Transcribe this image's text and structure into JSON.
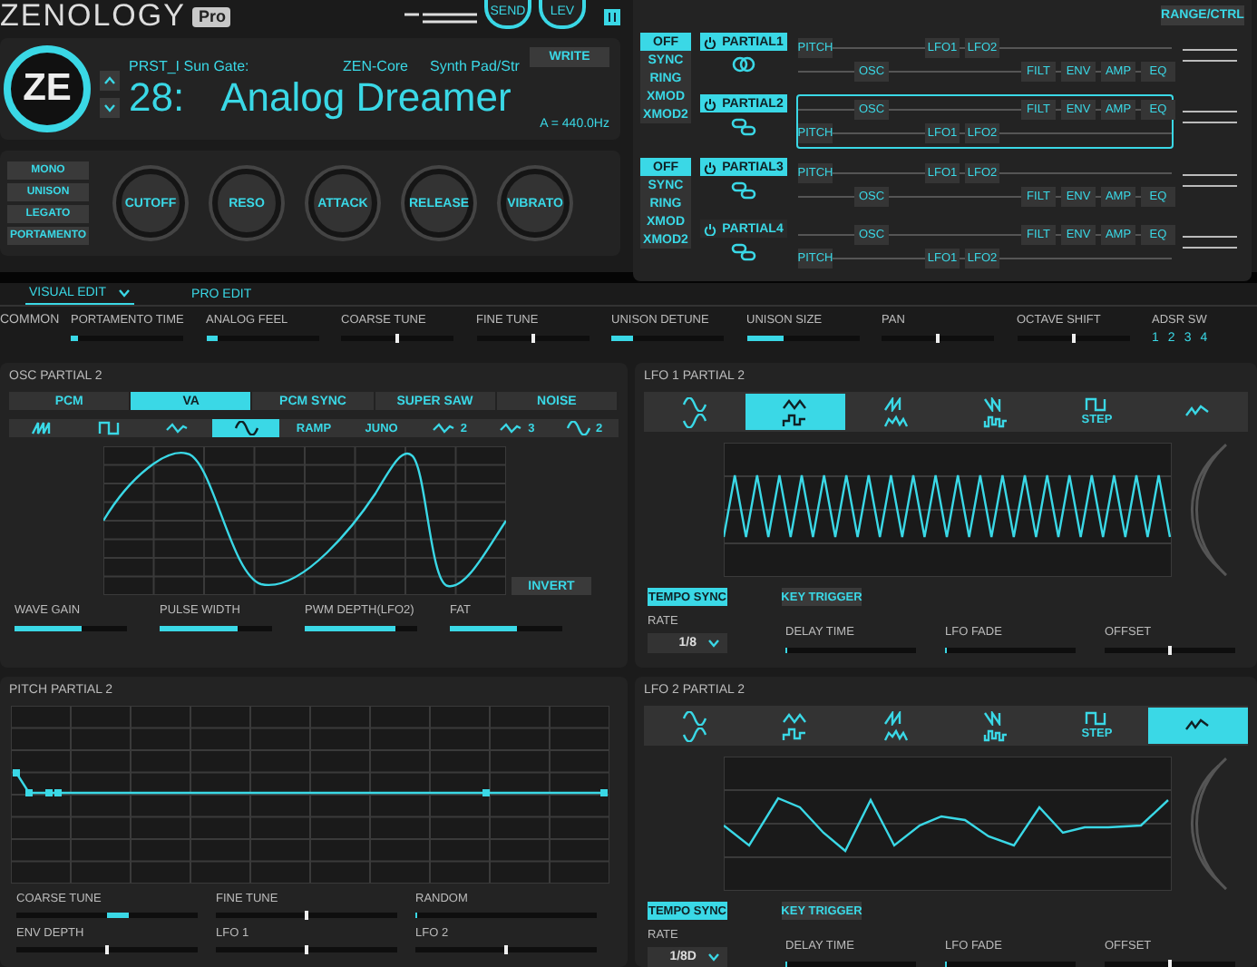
{
  "app": {
    "logo": "ZENOLOGY",
    "badge": "Pro",
    "send": "SEND",
    "lev": "LEV"
  },
  "patch": {
    "logo_mark": "ZE",
    "bank": "PRST_I Sun Gate:",
    "engine": "ZEN-Core",
    "category": "Synth Pad/Str",
    "number": "28:",
    "name": "Analog Dreamer",
    "write": "WRITE",
    "tuning": "A = 440.0Hz"
  },
  "mode_buttons": [
    "MONO",
    "UNISON",
    "LEGATO",
    "PORTAMENTO"
  ],
  "knobs": [
    "CUTOFF",
    "RESO",
    "ATTACK",
    "RELEASE",
    "VIBRATO"
  ],
  "structure": {
    "range_button": "RANGE/CTRL",
    "groups": [
      {
        "modes": [
          {
            "label": "OFF",
            "selected": true
          },
          {
            "label": "SYNC",
            "selected": false
          },
          {
            "label": "RING",
            "selected": false
          },
          {
            "label": "XMOD",
            "selected": false
          },
          {
            "label": "XMOD2",
            "selected": false
          }
        ],
        "partials": [
          {
            "label": "PARTIAL1",
            "on": true,
            "linked": true,
            "selected": false,
            "top": [
              {
                "kind": "pitch",
                "label": "PITCH"
              },
              {
                "kind": "lfo1",
                "label": "LFO1"
              },
              {
                "kind": "lfo2",
                "label": "LFO2"
              }
            ],
            "bottom": [
              {
                "kind": "osc",
                "label": "OSC"
              },
              {
                "kind": "filt",
                "label": "FILT"
              },
              {
                "kind": "env",
                "label": "ENV"
              },
              {
                "kind": "amp",
                "label": "AMP"
              },
              {
                "kind": "eq",
                "label": "EQ"
              }
            ]
          },
          {
            "label": "PARTIAL2",
            "on": true,
            "linked": false,
            "selected": true,
            "top": [
              {
                "kind": "osc",
                "label": "OSC"
              },
              {
                "kind": "filt",
                "label": "FILT"
              },
              {
                "kind": "env",
                "label": "ENV"
              },
              {
                "kind": "amp",
                "label": "AMP"
              },
              {
                "kind": "eq",
                "label": "EQ"
              }
            ],
            "bottom": [
              {
                "kind": "pitch",
                "label": "PITCH"
              },
              {
                "kind": "lfo1",
                "label": "LFO1"
              },
              {
                "kind": "lfo2",
                "label": "LFO2"
              }
            ]
          }
        ]
      },
      {
        "modes": [
          {
            "label": "OFF",
            "selected": true
          },
          {
            "label": "SYNC",
            "selected": false
          },
          {
            "label": "RING",
            "selected": false
          },
          {
            "label": "XMOD",
            "selected": false
          },
          {
            "label": "XMOD2",
            "selected": false
          }
        ],
        "partials": [
          {
            "label": "PARTIAL3",
            "on": true,
            "linked": false,
            "selected": false,
            "top": [
              {
                "kind": "pitch",
                "label": "PITCH"
              },
              {
                "kind": "lfo1",
                "label": "LFO1"
              },
              {
                "kind": "lfo2",
                "label": "LFO2"
              }
            ],
            "bottom": [
              {
                "kind": "osc",
                "label": "OSC"
              },
              {
                "kind": "filt",
                "label": "FILT"
              },
              {
                "kind": "env",
                "label": "ENV"
              },
              {
                "kind": "amp",
                "label": "AMP"
              },
              {
                "kind": "eq",
                "label": "EQ"
              }
            ]
          },
          {
            "label": "PARTIAL4",
            "on": false,
            "linked": false,
            "selected": false,
            "top": [
              {
                "kind": "osc",
                "label": "OSC"
              },
              {
                "kind": "filt",
                "label": "FILT"
              },
              {
                "kind": "env",
                "label": "ENV"
              },
              {
                "kind": "amp",
                "label": "AMP"
              },
              {
                "kind": "eq",
                "label": "EQ"
              }
            ],
            "bottom": [
              {
                "kind": "pitch",
                "label": "PITCH"
              },
              {
                "kind": "lfo1",
                "label": "LFO1"
              },
              {
                "kind": "lfo2",
                "label": "LFO2"
              }
            ]
          }
        ]
      }
    ]
  },
  "edit_tabs": [
    {
      "label": "VISUAL EDIT",
      "selected": true
    },
    {
      "label": "PRO EDIT",
      "selected": false
    }
  ],
  "common": {
    "label": "COMMON",
    "params": [
      {
        "label": "PORTAMENTO TIME",
        "kind": "bar",
        "level": 0.07
      },
      {
        "label": "ANALOG FEEL",
        "kind": "bar",
        "level": 0.1
      },
      {
        "label": "COARSE TUNE",
        "kind": "dot",
        "level": 0.5
      },
      {
        "label": "FINE TUNE",
        "kind": "dot",
        "level": 0.5
      },
      {
        "label": "UNISON DETUNE",
        "kind": "bar",
        "level": 0.2
      },
      {
        "label": "UNISON SIZE",
        "kind": "bar",
        "level": 0.33
      },
      {
        "label": "PAN",
        "kind": "dot",
        "level": 0.5
      },
      {
        "label": "OCTAVE SHIFT",
        "kind": "dot",
        "level": 0.5
      }
    ],
    "adsr_sw": {
      "label": "ADSR SW",
      "buttons": [
        "1",
        "2",
        "3",
        "4"
      ]
    }
  },
  "osc": {
    "title": "OSC PARTIAL 2",
    "types": [
      {
        "label": "PCM",
        "selected": false
      },
      {
        "label": "VA",
        "selected": true
      },
      {
        "label": "PCM SYNC",
        "selected": false
      },
      {
        "label": "SUPER SAW",
        "selected": false
      },
      {
        "label": "NOISE",
        "selected": false
      }
    ],
    "waves": [
      {
        "kind": "saw",
        "selected": false
      },
      {
        "kind": "square",
        "selected": false
      },
      {
        "kind": "triangle",
        "selected": false
      },
      {
        "kind": "sine",
        "selected": true
      },
      {
        "kind": "text",
        "label": "RAMP",
        "selected": false
      },
      {
        "kind": "text",
        "label": "JUNO",
        "selected": false
      },
      {
        "kind": "triangle",
        "label": "2",
        "selected": false
      },
      {
        "kind": "triangle",
        "label": "3",
        "selected": false
      },
      {
        "kind": "sine",
        "label": "2",
        "selected": false
      }
    ],
    "invert": "INVERT",
    "params": [
      {
        "label": "WAVE GAIN",
        "kind": "bar",
        "level": 0.6
      },
      {
        "label": "PULSE WIDTH",
        "kind": "bar",
        "level": 0.7
      },
      {
        "label": "PWM DEPTH(LFO2)",
        "kind": "bar",
        "level": 0.8
      },
      {
        "label": "FAT",
        "kind": "bar",
        "level": 0.6
      }
    ]
  },
  "lfo1": {
    "title": "LFO 1 PARTIAL 2",
    "shapes": [
      {
        "kind": "sine",
        "selected": false
      },
      {
        "kind": "triangle",
        "selected": true
      },
      {
        "kind": "sawup",
        "selected": false
      },
      {
        "kind": "sawdown",
        "selected": false
      },
      {
        "kind": "square",
        "label": "STEP",
        "selected": false
      },
      {
        "kind": "chaos",
        "selected": false
      }
    ],
    "graph": {
      "kind": "triangle"
    },
    "tempo_sync": {
      "label": "TEMPO SYNC",
      "on": true
    },
    "key_trigger": {
      "label": "KEY TRIGGER",
      "on": false
    },
    "rate": {
      "label": "RATE",
      "value": "1/8"
    },
    "params": [
      {
        "label": "DELAY TIME",
        "kind": "bar",
        "level": 0
      },
      {
        "label": "LFO FADE",
        "kind": "bar",
        "level": 0
      },
      {
        "label": "OFFSET",
        "kind": "dot",
        "level": 0.5
      }
    ]
  },
  "pitch": {
    "title": "PITCH PARTIAL 2",
    "params": [
      {
        "label": "COARSE TUNE",
        "kind": "bipolar",
        "level": 0.62
      },
      {
        "label": "FINE TUNE",
        "kind": "dot",
        "level": 0.5
      },
      {
        "label": "RANDOM",
        "kind": "bar",
        "level": 0
      },
      {
        "label": "ENV DEPTH",
        "kind": "dot",
        "level": 0.5
      },
      {
        "label": "LFO 1",
        "kind": "dot",
        "level": 0.5
      },
      {
        "label": "LFO 2",
        "kind": "dot",
        "level": 0.5
      }
    ]
  },
  "lfo2": {
    "title": "LFO 2 PARTIAL 2",
    "shapes": [
      {
        "kind": "sine",
        "selected": false
      },
      {
        "kind": "triangle",
        "selected": false
      },
      {
        "kind": "sawup",
        "selected": false
      },
      {
        "kind": "sawdown",
        "selected": false
      },
      {
        "kind": "square",
        "label": "STEP",
        "selected": false
      },
      {
        "kind": "chaos",
        "selected": true
      }
    ],
    "graph": {
      "kind": "random"
    },
    "tempo_sync": {
      "label": "TEMPO SYNC",
      "on": true
    },
    "key_trigger": {
      "label": "KEY TRIGGER",
      "on": false
    },
    "rate": {
      "label": "RATE",
      "value": "1/8D"
    },
    "params": [
      {
        "label": "DELAY TIME",
        "kind": "bar",
        "level": 0
      },
      {
        "label": "LFO FADE",
        "kind": "bar",
        "level": 0
      },
      {
        "label": "OFFSET",
        "kind": "dot",
        "level": 0.5
      }
    ]
  }
}
